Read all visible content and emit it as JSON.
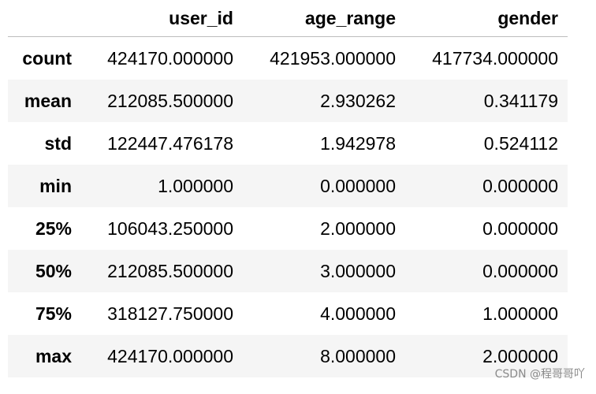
{
  "table": {
    "index_header": "",
    "columns": [
      "user_id",
      "age_range",
      "gender"
    ],
    "rows": [
      {
        "label": "count",
        "values": [
          "424170.000000",
          "421953.000000",
          "417734.000000"
        ]
      },
      {
        "label": "mean",
        "values": [
          "212085.500000",
          "2.930262",
          "0.341179"
        ]
      },
      {
        "label": "std",
        "values": [
          "122447.476178",
          "1.942978",
          "0.524112"
        ]
      },
      {
        "label": "min",
        "values": [
          "1.000000",
          "0.000000",
          "0.000000"
        ]
      },
      {
        "label": "25%",
        "values": [
          "106043.250000",
          "2.000000",
          "0.000000"
        ]
      },
      {
        "label": "50%",
        "values": [
          "212085.500000",
          "3.000000",
          "0.000000"
        ]
      },
      {
        "label": "75%",
        "values": [
          "318127.750000",
          "4.000000",
          "1.000000"
        ]
      },
      {
        "label": "max",
        "values": [
          "424170.000000",
          "8.000000",
          "2.000000"
        ]
      }
    ]
  },
  "watermark": "CSDN @程哥哥吖"
}
